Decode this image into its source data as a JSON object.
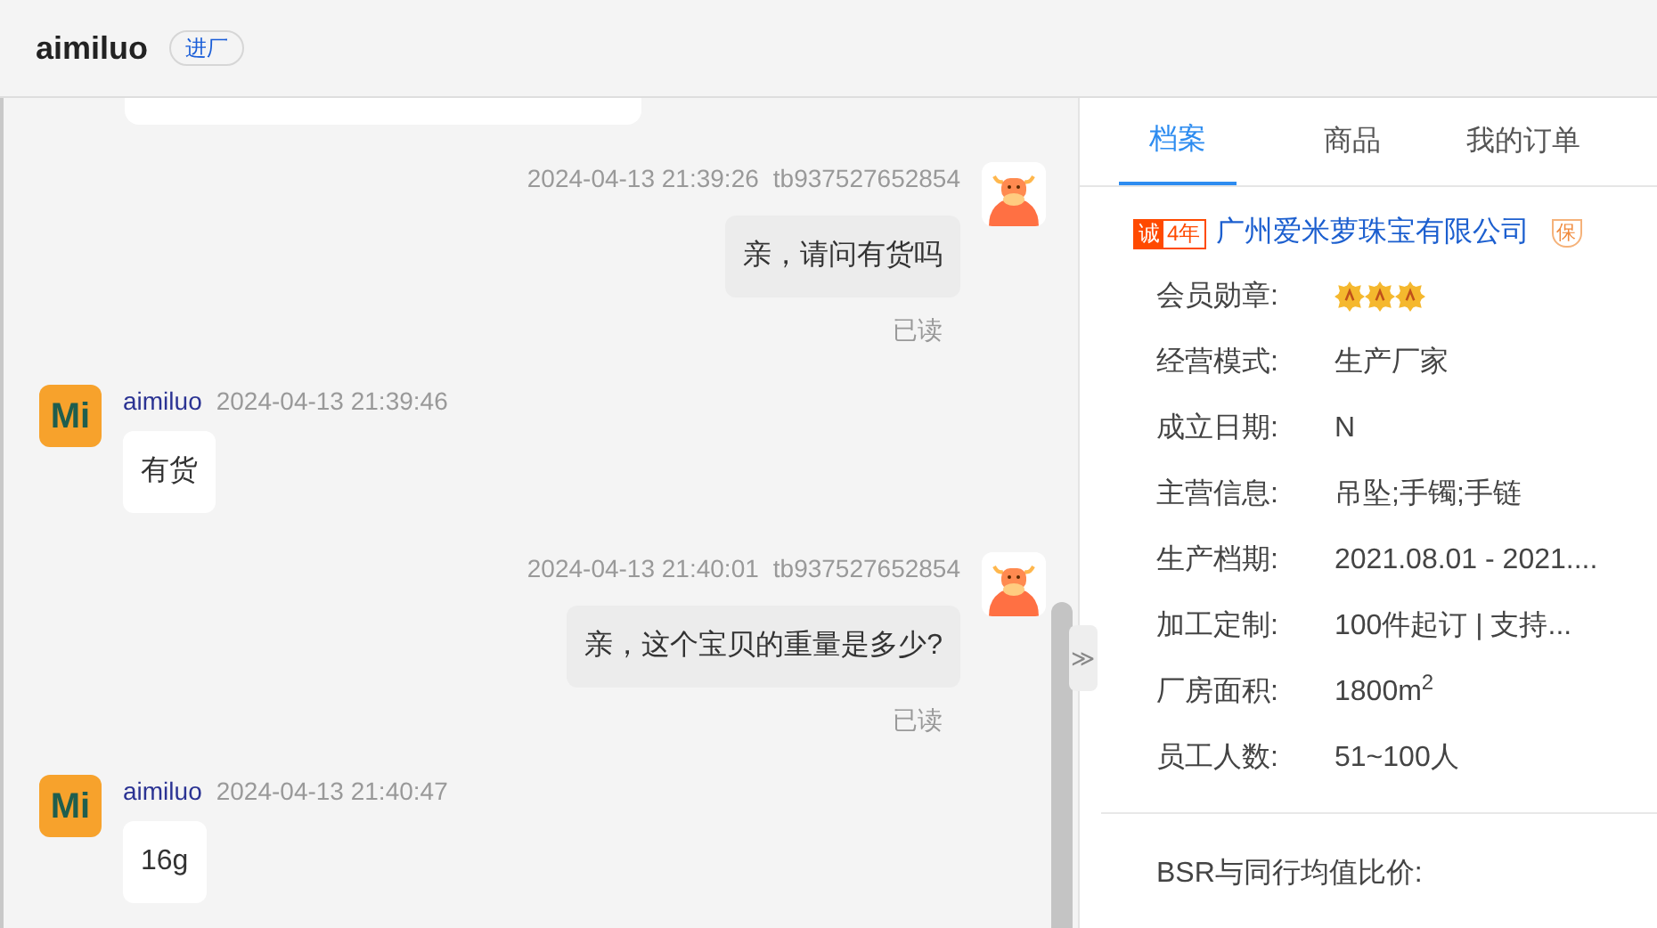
{
  "header": {
    "title": "aimiluo",
    "tag": "进厂"
  },
  "messages": [
    {
      "kind": "sent",
      "time": "2024-04-13 21:39:26",
      "user": "tb937527652854",
      "text": "亲，请问有货吗",
      "status": "已读"
    },
    {
      "kind": "received",
      "avatar_text": "Mi",
      "user": "aimiluo",
      "time": "2024-04-13 21:39:46",
      "text": "有货"
    },
    {
      "kind": "sent",
      "time": "2024-04-13 21:40:01",
      "user": "tb937527652854",
      "text": "亲，这个宝贝的重量是多少?",
      "status": "已读"
    },
    {
      "kind": "received",
      "avatar_text": "Mi",
      "user": "aimiluo",
      "time": "2024-04-13 21:40:47",
      "text": "16g"
    }
  ],
  "expand_button": "≫",
  "tabs": [
    {
      "label": "档案",
      "selected": true
    },
    {
      "label": "商品",
      "selected": false
    },
    {
      "label": "我的订单",
      "selected": false
    }
  ],
  "company": {
    "badge_mark": "诚",
    "badge_years": "4年",
    "name": "广州爱米萝珠宝有限公司",
    "guarantee": "保"
  },
  "fields": [
    {
      "label": "会员勋章:",
      "kind": "medals",
      "medals": [
        {
          "kind": "medal"
        },
        {
          "kind": "medal"
        },
        {
          "kind": "medal"
        }
      ]
    },
    {
      "label": "经营模式:",
      "kind": "text",
      "value": "生产厂家"
    },
    {
      "label": "成立日期:",
      "kind": "text",
      "value": "N"
    },
    {
      "label": "主营信息:",
      "kind": "text",
      "value": "吊坠;手镯;手链"
    },
    {
      "label": "生产档期:",
      "kind": "text",
      "value": "2021.08.01 - 2021...."
    },
    {
      "label": "加工定制:",
      "kind": "text",
      "value": "100件起订 | 支持..."
    },
    {
      "label": "厂房面积:",
      "kind": "text",
      "value": "1800m$^{2}$"
    },
    {
      "label": "员工人数:",
      "kind": "text",
      "value": "51~100人"
    }
  ],
  "bsr_label": "BSR与同行均值比价:"
}
